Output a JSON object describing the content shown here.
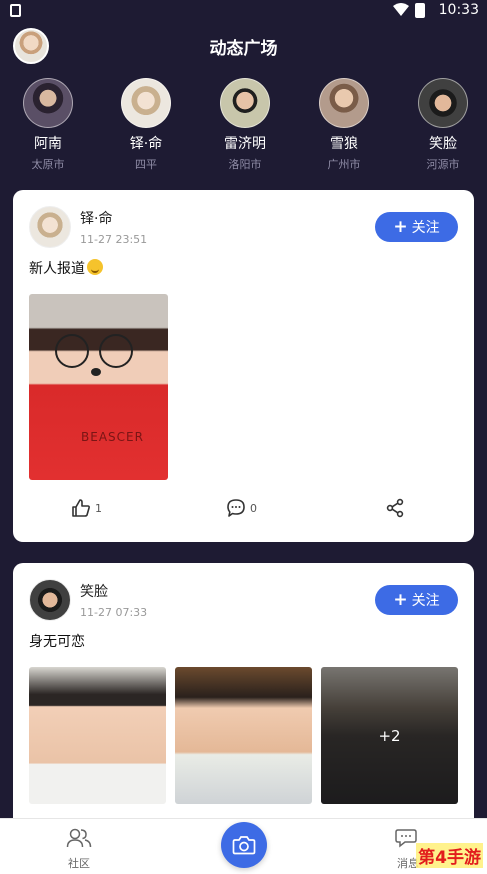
{
  "status_bar": {
    "time": "10:33"
  },
  "header": {
    "title": "动态广场"
  },
  "recommended_users": [
    {
      "name": "阿南",
      "city": "太原市",
      "avatar_color": "#4a3f52"
    },
    {
      "name": "铎·命",
      "city": "四平",
      "avatar_color": "#e6dbc8"
    },
    {
      "name": "雷济明",
      "city": "洛阳市",
      "avatar_color": "#c9c1a8"
    },
    {
      "name": "雪狼",
      "city": "广州市",
      "avatar_color": "#b59a8a"
    },
    {
      "name": "笑脸",
      "city": "河源市",
      "avatar_color": "#3b3838"
    }
  ],
  "posts": [
    {
      "username": "铎·命",
      "time": "11-27 23:51",
      "follow_label": "关注",
      "text": "新人报道",
      "likes": "1",
      "comments": "0",
      "photo_text": "BEASCER"
    },
    {
      "username": "笑脸",
      "time": "11-27 07:33",
      "follow_label": "关注",
      "text": "身无可恋",
      "more_photos": "+2"
    }
  ],
  "bottom_nav": {
    "community": "社区",
    "message": "消息"
  },
  "watermark": "第4手游",
  "colors": {
    "accent": "#3d6be5",
    "background": "#1e1b33"
  }
}
